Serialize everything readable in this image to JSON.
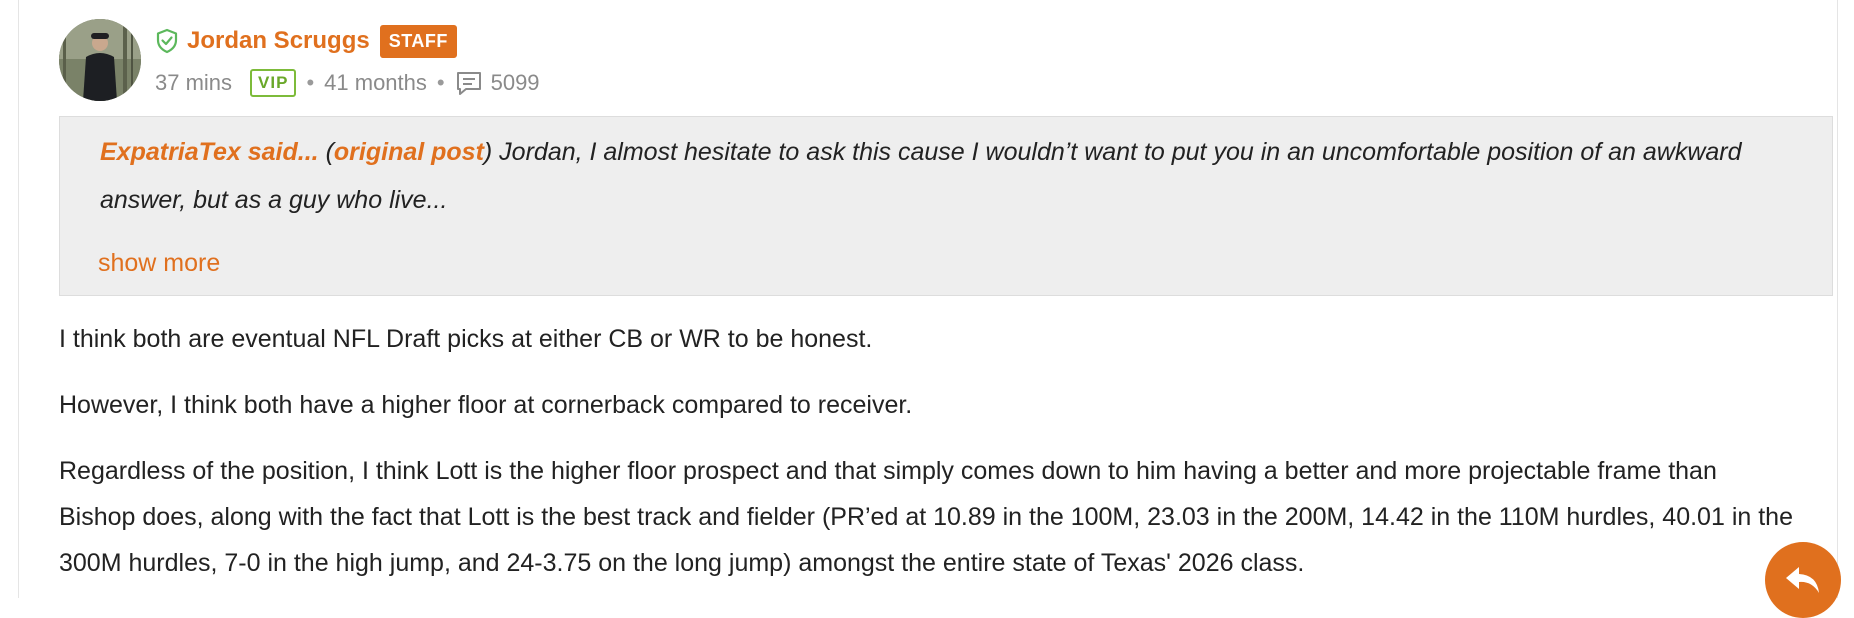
{
  "post": {
    "author": {
      "name": "Jordan Scruggs",
      "badge": "STAFF",
      "avatar_icon": "user-avatar-photo",
      "verified_icon": "shield-check-icon"
    },
    "meta": {
      "time": "37 mins",
      "tier": "VIP",
      "tenure": "41 months",
      "post_count": "5099",
      "separator": "•"
    },
    "quote": {
      "author": "ExpatriaTex said...",
      "open_paren": "(",
      "link_label": "original post",
      "close_paren": ")",
      "text": " Jordan, I almost hesitate to ask this cause I wouldn’t want to put you in an uncomfortable position of an awkward answer, but as a guy who live...",
      "show_more": "show more"
    },
    "paragraphs": [
      "I think both are eventual NFL Draft picks at either CB or WR to be honest.",
      "However, I think both have a higher floor at cornerback compared to receiver.",
      "Regardless of the position, I think Lott is the higher floor prospect and that simply comes down to him having a better and more projectable frame than Bishop does, along with the fact that Lott is the best track and fielder (PR’ed at 10.89 in the 100M, 23.03 in the 200M, 14.42 in the 110M hurdles, 40.01 in the 300M hurdles, 7-0 in the high jump, and 24-3.75 on the long jump) amongst the entire state of Texas' 2026 class."
    ]
  },
  "colors": {
    "accent": "#e0701e",
    "vip": "#7dbb3a",
    "quote_bg": "#eeeeee",
    "meta_text": "#8a8a8a"
  }
}
